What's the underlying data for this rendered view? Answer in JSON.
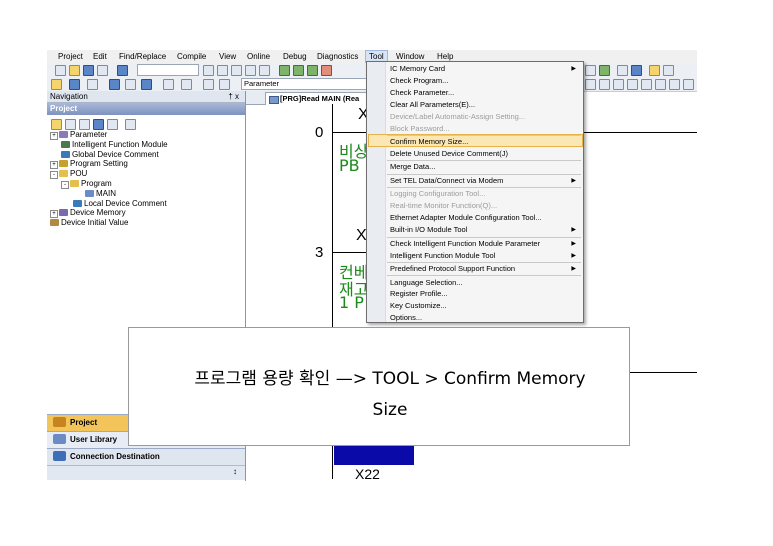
{
  "menubar": {
    "items": [
      "Project",
      "Edit",
      "Find/Replace",
      "Compile",
      "View",
      "Online",
      "Debug",
      "Diagnostics",
      "Tool",
      "Window",
      "Help"
    ],
    "active": "Tool"
  },
  "toolbar2": {
    "combo_value": "Parameter"
  },
  "navigation": {
    "title": "Navigation",
    "pin": "† x",
    "project_label": "Project",
    "tree": [
      {
        "label": "Parameter",
        "level": 0,
        "expander": true,
        "icon": "parameter-icon"
      },
      {
        "label": "Intelligent Function Module",
        "level": 1,
        "icon": "module-icon"
      },
      {
        "label": "Global Device Comment",
        "level": 1,
        "icon": "comment-icon"
      },
      {
        "label": "Program Setting",
        "level": 0,
        "expander": true,
        "icon": "program-setting-icon"
      },
      {
        "label": "POU",
        "level": 0,
        "expander": true,
        "icon": "folder-icon"
      },
      {
        "label": "Program",
        "level": 1,
        "expander": true,
        "icon": "folder-icon"
      },
      {
        "label": "MAIN",
        "level": 3,
        "icon": "program-icon"
      },
      {
        "label": "Local Device Comment",
        "level": 2,
        "icon": "comment-icon"
      },
      {
        "label": "Device Memory",
        "level": 0,
        "expander": true,
        "icon": "memory-icon"
      },
      {
        "label": "Device Initial Value",
        "level": 0,
        "icon": "initial-value-icon"
      }
    ],
    "panels": [
      "Project",
      "User Library",
      "Connection Destination"
    ]
  },
  "editor": {
    "tab_label": "[PRG]Read MAIN (Rea",
    "steps": [
      "0",
      "3"
    ],
    "contacts": [
      "X",
      "X",
      "X22"
    ],
    "comments": [
      "비상",
      "PB",
      "컨베",
      "재고",
      "1 P"
    ]
  },
  "tool_menu": {
    "items": [
      {
        "label": "IC Memory Card",
        "arrow": true,
        "enabled": true
      },
      {
        "label": "Check Program...",
        "enabled": true
      },
      {
        "label": "Check Parameter...",
        "enabled": true
      },
      {
        "label": "Clear All Parameters(E)...",
        "enabled": true
      },
      {
        "label": "Device/Label Automatic-Assign Setting...",
        "enabled": false
      },
      {
        "label": "Block Password...",
        "enabled": false,
        "sep_after": true
      },
      {
        "label": "Confirm Memory Size...",
        "enabled": true,
        "highlight": true
      },
      {
        "label": "Delete Unused Device Comment(J)",
        "enabled": true,
        "sep_after": true
      },
      {
        "label": "Merge Data...",
        "enabled": true,
        "sep_after": true
      },
      {
        "label": "Set TEL Data/Connect via Modem",
        "arrow": true,
        "enabled": true,
        "sep_after": true
      },
      {
        "label": "Logging Configuration Tool...",
        "enabled": false
      },
      {
        "label": "Real-time Monitor Function(Q)...",
        "enabled": false
      },
      {
        "label": "Ethernet Adapter Module Configuration Tool...",
        "enabled": true
      },
      {
        "label": "Built-in I/O Module Tool",
        "arrow": true,
        "enabled": true,
        "sep_after": true
      },
      {
        "label": "Check Intelligent Function Module Parameter",
        "arrow": true,
        "enabled": true
      },
      {
        "label": "Intelligent Function Module Tool",
        "arrow": true,
        "enabled": true,
        "sep_after": true
      },
      {
        "label": "Predefined Protocol Support Function",
        "arrow": true,
        "enabled": true,
        "sep_after": true
      },
      {
        "label": "Language Selection...",
        "enabled": true
      },
      {
        "label": "Register Profile...",
        "enabled": true
      },
      {
        "label": "Key Customize...",
        "enabled": true
      },
      {
        "label": "Options...",
        "enabled": true
      }
    ]
  },
  "callout": {
    "line1": "프로그램 용량 확인 —> TOOL > Confirm Memory",
    "line2": "Size"
  },
  "colors": {
    "highlight": "#fbe7b4",
    "ladder_comment": "#1a8a1a",
    "block": "#0a0aa8"
  }
}
